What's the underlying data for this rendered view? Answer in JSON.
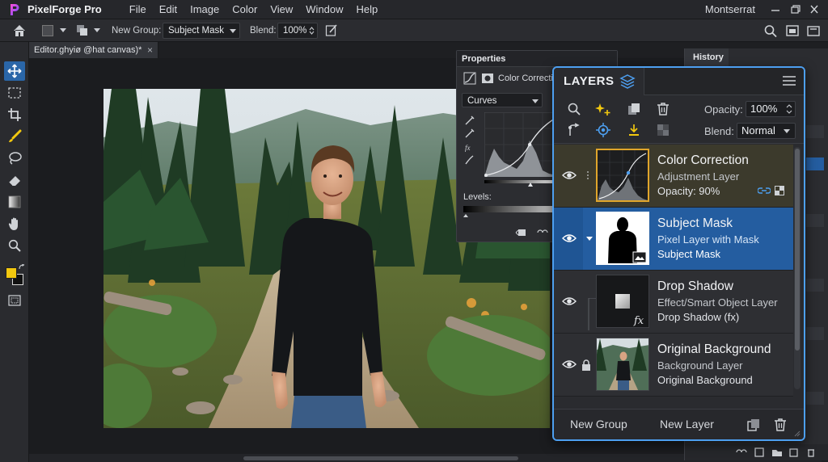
{
  "app": {
    "name": "PixelForge Pro"
  },
  "menu": [
    "File",
    "Edit",
    "Image",
    "Color",
    "View",
    "Window",
    "Help"
  ],
  "window": {
    "font_name": "Montserrat"
  },
  "options_bar": {
    "new_group_label": "New Group:",
    "new_group_value": "Subject Mask",
    "blend_label": "Blend:",
    "blend_value": "100%",
    "foreground_color": "#4a4b4f"
  },
  "document": {
    "tab_title": "Editor.ghyiø @hat canvas)*",
    "close_glyph": "×"
  },
  "toolbar": {
    "tools": [
      "move-icon",
      "marquee-icon",
      "crop-icon",
      "brush-icon",
      "lasso-icon",
      "eraser-icon",
      "gradient-icon",
      "hand-icon",
      "zoom-icon",
      "color-swatches",
      "quick-mask-icon"
    ],
    "foreground": "#f2c80f",
    "background": "#111111"
  },
  "properties": {
    "title": "Properties",
    "adjustment_name": "Color Correction",
    "curve_type": "Curves",
    "levels_label": "Levels:"
  },
  "history": {
    "title": "History"
  },
  "layers": {
    "title": "LAYERS",
    "opacity_label": "Opacity:",
    "opacity_value": "100%",
    "blend_label": "Blend:",
    "blend_value": "Normal",
    "items": [
      {
        "name": "Color Correction",
        "type": "Adjustment Layer",
        "extra": "Opacity: 90%",
        "visible": true,
        "selected": false
      },
      {
        "name": "Subject Mask",
        "type": "Pixel Layer with Mask",
        "extra": "Subject Mask",
        "visible": true,
        "selected": true
      },
      {
        "name": "Drop Shadow",
        "type": "Effect/Smart Object Layer",
        "extra": "Drop Shadow (fx)",
        "visible": true,
        "selected": false
      },
      {
        "name": "Original Background",
        "type": "Background Layer",
        "extra": "Original Background",
        "visible": true,
        "selected": false,
        "locked": true
      }
    ],
    "fx_label": "fx",
    "footer": {
      "new_group": "New Group",
      "new_layer": "New Layer"
    }
  },
  "colors": {
    "accent": "#4d9ff0",
    "selection": "#245da0",
    "adjustment_row": "#3c3a2c"
  }
}
